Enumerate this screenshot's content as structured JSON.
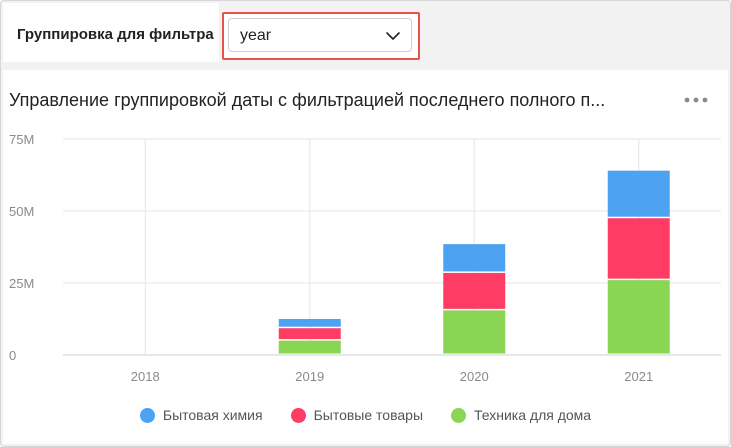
{
  "filter": {
    "label": "Группировка для фильтра",
    "selected": "year"
  },
  "card": {
    "title": "Управление группировкой даты с фильтрацией последнего полного п..."
  },
  "colors": {
    "highlight": "#e5534b",
    "chemistry": "#4da2f1",
    "goods": "#ff3d64",
    "appliances": "#8ad554"
  },
  "chart_data": {
    "type": "bar",
    "stacked": true,
    "categories": [
      "2018",
      "2019",
      "2020",
      "2021"
    ],
    "series": [
      {
        "name": "Техника для дома",
        "color": "#8ad554",
        "values": [
          0,
          5,
          15.5,
          26
        ]
      },
      {
        "name": "Бытовые товары",
        "color": "#ff3d64",
        "values": [
          0,
          4.3,
          13,
          21.5
        ]
      },
      {
        "name": "Бытовая химия",
        "color": "#4da2f1",
        "values": [
          0,
          3.2,
          10,
          16.5
        ]
      }
    ],
    "y_ticks": [
      {
        "value": 0,
        "label": "0"
      },
      {
        "value": 25,
        "label": "25M"
      },
      {
        "value": 50,
        "label": "50M"
      },
      {
        "value": 75,
        "label": "75M"
      }
    ],
    "ylim": [
      0,
      75
    ],
    "legend_order": [
      "Бытовая химия",
      "Бытовые товары",
      "Техника для дома"
    ],
    "legend_position": "bottom",
    "grid": true
  }
}
